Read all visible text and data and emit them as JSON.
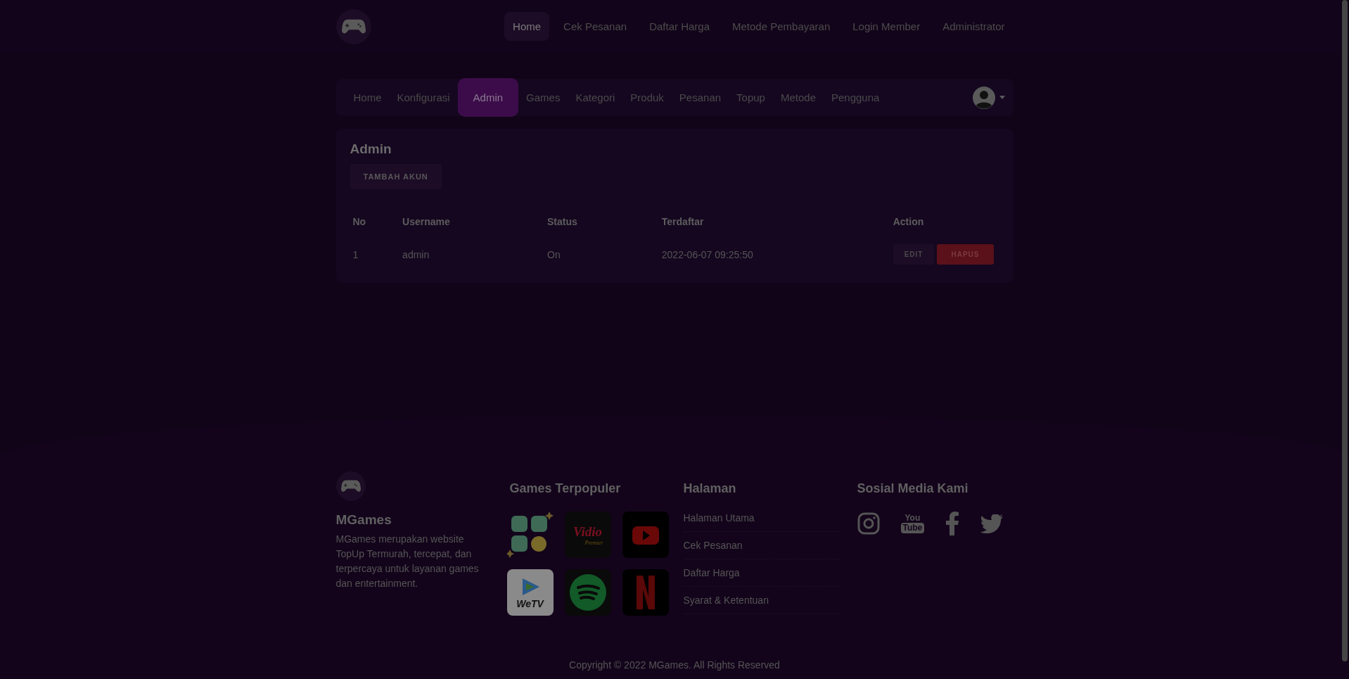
{
  "top_nav": {
    "items": [
      {
        "label": "Home",
        "selected": true
      },
      {
        "label": "Cek Pesanan",
        "selected": false
      },
      {
        "label": "Daftar Harga",
        "selected": false
      },
      {
        "label": "Metode Pembayaran",
        "selected": false
      },
      {
        "label": "Login Member",
        "selected": false
      },
      {
        "label": "Administrator",
        "selected": false
      }
    ]
  },
  "admin_nav": {
    "items": [
      {
        "label": "Home",
        "selected": false
      },
      {
        "label": "Konfigurasi",
        "selected": false
      },
      {
        "label": "Admin",
        "selected": true
      },
      {
        "label": "Games",
        "selected": false
      },
      {
        "label": "Kategori",
        "selected": false
      },
      {
        "label": "Produk",
        "selected": false
      },
      {
        "label": "Pesanan",
        "selected": false
      },
      {
        "label": "Topup",
        "selected": false
      },
      {
        "label": "Metode",
        "selected": false
      },
      {
        "label": "Pengguna",
        "selected": false
      }
    ]
  },
  "card": {
    "title": "Admin",
    "add_button": "TAMBAH AKUN",
    "table": {
      "columns": [
        "No",
        "Username",
        "Status",
        "Terdaftar",
        "Action"
      ],
      "rows": [
        {
          "cells": [
            "1",
            "admin",
            "On",
            "2022-06-07 09:25:50"
          ],
          "actions": [
            {
              "kind": "edit",
              "label": "EDIT"
            },
            {
              "kind": "delete",
              "label": "HAPUS"
            }
          ]
        }
      ]
    }
  },
  "footer": {
    "brand": "MGames",
    "description": "MGames merupakan website TopUp Termurah, tercepat, dan terpercaya untuk layanan games dan entertainment.",
    "games_title": "Games Terpopuler",
    "games": [
      {
        "kind": "coins"
      },
      {
        "kind": "vidio",
        "text": "Vidio",
        "subtext": "Premier"
      },
      {
        "kind": "youtube"
      },
      {
        "kind": "wetv",
        "text": "WeTV"
      },
      {
        "kind": "spotify"
      },
      {
        "kind": "netflix"
      }
    ],
    "pages_title": "Halaman",
    "pages": [
      "Halaman Utama",
      "Cek Pesanan",
      "Daftar Harga",
      "Syarat & Ketentuan"
    ],
    "social_title": "Sosial Media Kami",
    "social": [
      {
        "kind": "instagram"
      },
      {
        "kind": "youtube",
        "text": "You",
        "subtext": "Tube"
      },
      {
        "kind": "facebook"
      },
      {
        "kind": "twitter"
      }
    ],
    "copyright": "Copyright © 2022 MGames. All Rights Reserved"
  }
}
